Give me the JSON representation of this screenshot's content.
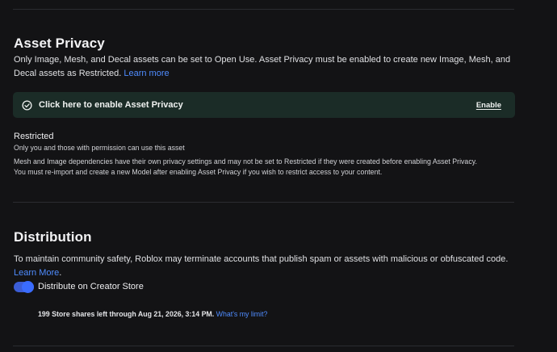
{
  "asset_privacy": {
    "title": "Asset Privacy",
    "description": "Only Image, Mesh, and Decal assets can be set to Open Use. Asset Privacy must be enabled to create new Image, Mesh, and Decal assets as Restricted.",
    "learn_more": "Learn more",
    "banner": {
      "icon": "check-circle-icon",
      "text": "Click here to enable Asset Privacy",
      "action": "Enable",
      "background": "#1b2c27"
    },
    "restricted_label": "Restricted",
    "restricted_desc": "Only you and those with permission can use this asset",
    "note_line1": "Mesh and Image dependencies have their own privacy settings and may not be set to Restricted if they were created before enabling Asset Privacy.",
    "note_line2": "You must re-import and create a new Model after enabling Asset Privacy if you wish to restrict access to your content."
  },
  "distribution": {
    "title": "Distribution",
    "description": "To maintain community safety, Roblox may terminate accounts that publish spam or assets with malicious or obfuscated code.",
    "learn_more": "Learn More",
    "learn_more_suffix": ".",
    "toggle": {
      "label": "Distribute on Creator Store",
      "on": true,
      "color": "#3a6cff"
    },
    "shares_text": "199 Store shares left through Aug 21, 2026, 3:14 PM.",
    "limit_link": "What's my limit?"
  },
  "colors": {
    "background": "#131315",
    "link": "#4f8cff",
    "divider": "#2b2c30"
  }
}
